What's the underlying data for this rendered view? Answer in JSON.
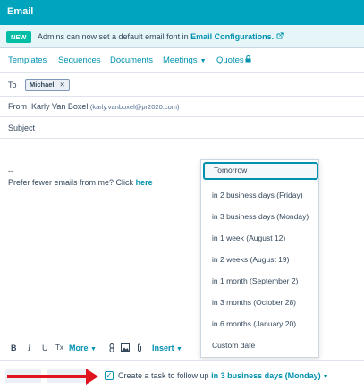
{
  "window": {
    "title": "Email"
  },
  "notice": {
    "badge": "NEW",
    "message": "Admins can now set a default email font in",
    "link": "Email Configurations.",
    "link_icon": "external-link-icon"
  },
  "tabs": [
    {
      "label": "Templates"
    },
    {
      "label": "Sequences"
    },
    {
      "label": "Documents"
    },
    {
      "label": "Meetings",
      "has_caret": true
    },
    {
      "label": "Quotes",
      "icon": "lock-icon"
    }
  ],
  "to": {
    "label": "To",
    "recipient": "Michael",
    "remove": "✕"
  },
  "from": {
    "label": "From",
    "name": "Karly Van Boxel",
    "email": "(karly.vanboxel@pr2020.com)"
  },
  "subject": {
    "label": "Subject",
    "value": ""
  },
  "body": {
    "signature_sep": "--",
    "prefer_text": "Prefer fewer emails from me? Click",
    "prefer_link": "here"
  },
  "dropdown": {
    "options": [
      "Tomorrow",
      "in 2 business days (Friday)",
      "in 3 business days (Monday)",
      "in 1 week (August 12)",
      "in 2 weeks (August 19)",
      "in 1 month (September 2)",
      "in 3 months (October 28)",
      "in 6 months (January 20)",
      "Custom date"
    ],
    "highlighted": "Tomorrow"
  },
  "toolbar": {
    "bold": "B",
    "italic": "I",
    "underline": "U",
    "clear_format": "Tx",
    "more": "More",
    "insert": "Insert"
  },
  "footer": {
    "task_prefix": "Create a task to follow up",
    "task_selected": "in 3 business days (Monday)",
    "checked": true
  },
  "colors": {
    "header": "#00a4bd",
    "accent": "#0091ae",
    "badge": "#00bda5",
    "arrow": "#e0141e"
  }
}
